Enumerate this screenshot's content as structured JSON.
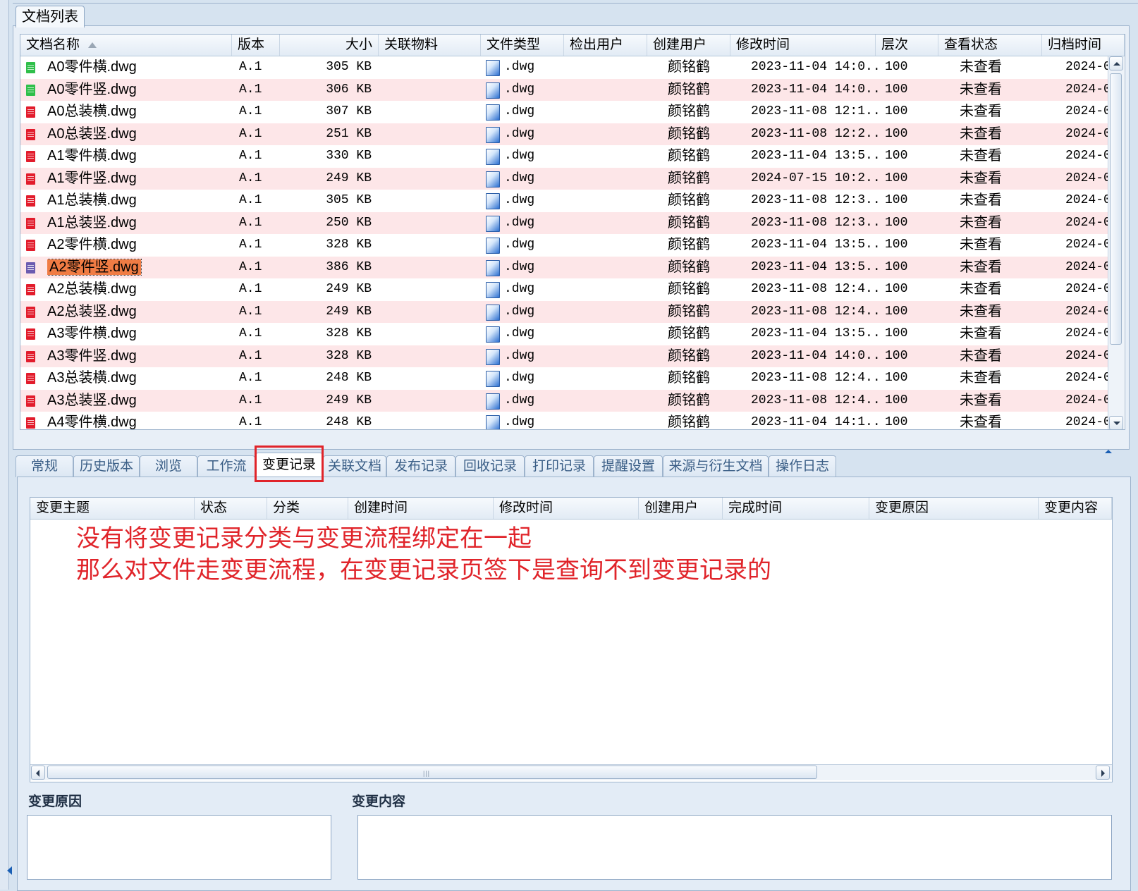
{
  "doc_list_tab": "文档列表",
  "grid1": {
    "columns": [
      "文档名称",
      "版本",
      "大小",
      "关联物料",
      "文件类型",
      "检出用户",
      "创建用户",
      "修改时间",
      "层次",
      "查看状态",
      "归档时间"
    ],
    "sort_column": "文档名称",
    "sort_order": "ascending",
    "rows": [
      {
        "name": "A0零件横.dwg",
        "version": "A.1",
        "size": "305 KB",
        "material": "",
        "type": ".dwg",
        "checkout": "",
        "creator": "颜铭鹤",
        "modified": "2023-11-04 14:0...",
        "level": "100",
        "view": "未查看",
        "archived": "2024-0",
        "icon_color": "#2fbf4a"
      },
      {
        "name": "A0零件竖.dwg",
        "version": "A.1",
        "size": "306 KB",
        "material": "",
        "type": ".dwg",
        "checkout": "",
        "creator": "颜铭鹤",
        "modified": "2023-11-04 14:0...",
        "level": "100",
        "view": "未查看",
        "archived": "2024-0",
        "icon_color": "#2fbf4a"
      },
      {
        "name": "A0总装横.dwg",
        "version": "A.1",
        "size": "307 KB",
        "material": "",
        "type": ".dwg",
        "checkout": "",
        "creator": "颜铭鹤",
        "modified": "2023-11-08 12:1...",
        "level": "100",
        "view": "未查看",
        "archived": "2024-0",
        "icon_color": "#e21c2c"
      },
      {
        "name": "A0总装竖.dwg",
        "version": "A.1",
        "size": "251 KB",
        "material": "",
        "type": ".dwg",
        "checkout": "",
        "creator": "颜铭鹤",
        "modified": "2023-11-08 12:2...",
        "level": "100",
        "view": "未查看",
        "archived": "2024-0",
        "icon_color": "#e21c2c"
      },
      {
        "name": "A1零件横.dwg",
        "version": "A.1",
        "size": "330 KB",
        "material": "",
        "type": ".dwg",
        "checkout": "",
        "creator": "颜铭鹤",
        "modified": "2023-11-04 13:5...",
        "level": "100",
        "view": "未查看",
        "archived": "2024-0",
        "icon_color": "#e21c2c"
      },
      {
        "name": "A1零件竖.dwg",
        "version": "A.1",
        "size": "249 KB",
        "material": "",
        "type": ".dwg",
        "checkout": "",
        "creator": "颜铭鹤",
        "modified": "2024-07-15 10:2...",
        "level": "100",
        "view": "未查看",
        "archived": "2024-0",
        "icon_color": "#e21c2c"
      },
      {
        "name": "A1总装横.dwg",
        "version": "A.1",
        "size": "305 KB",
        "material": "",
        "type": ".dwg",
        "checkout": "",
        "creator": "颜铭鹤",
        "modified": "2023-11-08 12:3...",
        "level": "100",
        "view": "未查看",
        "archived": "2024-0",
        "icon_color": "#e21c2c"
      },
      {
        "name": "A1总装竖.dwg",
        "version": "A.1",
        "size": "250 KB",
        "material": "",
        "type": ".dwg",
        "checkout": "",
        "creator": "颜铭鹤",
        "modified": "2023-11-08 12:3...",
        "level": "100",
        "view": "未查看",
        "archived": "2024-0",
        "icon_color": "#e21c2c"
      },
      {
        "name": "A2零件横.dwg",
        "version": "A.1",
        "size": "328 KB",
        "material": "",
        "type": ".dwg",
        "checkout": "",
        "creator": "颜铭鹤",
        "modified": "2023-11-04 13:5...",
        "level": "100",
        "view": "未查看",
        "archived": "2024-0",
        "icon_color": "#e21c2c"
      },
      {
        "name": "A2零件竖.dwg",
        "version": "A.1",
        "size": "386 KB",
        "material": "",
        "type": ".dwg",
        "checkout": "",
        "creator": "颜铭鹤",
        "modified": "2023-11-04 13:5...",
        "level": "100",
        "view": "未查看",
        "archived": "2024-0",
        "icon_color": "#6b5bb0",
        "selected": true
      },
      {
        "name": "A2总装横.dwg",
        "version": "A.1",
        "size": "249 KB",
        "material": "",
        "type": ".dwg",
        "checkout": "",
        "creator": "颜铭鹤",
        "modified": "2023-11-08 12:4...",
        "level": "100",
        "view": "未查看",
        "archived": "2024-0",
        "icon_color": "#e21c2c"
      },
      {
        "name": "A2总装竖.dwg",
        "version": "A.1",
        "size": "249 KB",
        "material": "",
        "type": ".dwg",
        "checkout": "",
        "creator": "颜铭鹤",
        "modified": "2023-11-08 12:4...",
        "level": "100",
        "view": "未查看",
        "archived": "2024-0",
        "icon_color": "#e21c2c"
      },
      {
        "name": "A3零件横.dwg",
        "version": "A.1",
        "size": "328 KB",
        "material": "",
        "type": ".dwg",
        "checkout": "",
        "creator": "颜铭鹤",
        "modified": "2023-11-04 13:5...",
        "level": "100",
        "view": "未查看",
        "archived": "2024-0",
        "icon_color": "#e21c2c"
      },
      {
        "name": "A3零件竖.dwg",
        "version": "A.1",
        "size": "328 KB",
        "material": "",
        "type": ".dwg",
        "checkout": "",
        "creator": "颜铭鹤",
        "modified": "2023-11-04 14:0...",
        "level": "100",
        "view": "未查看",
        "archived": "2024-0",
        "icon_color": "#e21c2c"
      },
      {
        "name": "A3总装横.dwg",
        "version": "A.1",
        "size": "248 KB",
        "material": "",
        "type": ".dwg",
        "checkout": "",
        "creator": "颜铭鹤",
        "modified": "2023-11-08 12:4...",
        "level": "100",
        "view": "未查看",
        "archived": "2024-0",
        "icon_color": "#e21c2c"
      },
      {
        "name": "A3总装竖.dwg",
        "version": "A.1",
        "size": "249 KB",
        "material": "",
        "type": ".dwg",
        "checkout": "",
        "creator": "颜铭鹤",
        "modified": "2023-11-08 12:4...",
        "level": "100",
        "view": "未查看",
        "archived": "2024-0",
        "icon_color": "#e21c2c"
      },
      {
        "name": "A4零件横.dwg",
        "version": "A.1",
        "size": "248 KB",
        "material": "",
        "type": ".dwg",
        "checkout": "",
        "creator": "颜铭鹤",
        "modified": "2023-11-04 14:1...",
        "level": "100",
        "view": "未查看",
        "archived": "2024-0",
        "icon_color": "#e21c2c"
      }
    ]
  },
  "tabs": [
    {
      "label": "常规"
    },
    {
      "label": "历史版本"
    },
    {
      "label": "浏览"
    },
    {
      "label": "工作流"
    },
    {
      "label": "变更记录",
      "active": true
    },
    {
      "label": "关联文档"
    },
    {
      "label": "发布记录"
    },
    {
      "label": "回收记录"
    },
    {
      "label": "打印记录"
    },
    {
      "label": "提醒设置"
    },
    {
      "label": "来源与衍生文档"
    },
    {
      "label": "操作日志"
    }
  ],
  "grid2": {
    "columns": [
      "变更主题",
      "状态",
      "分类",
      "创建时间",
      "修改时间",
      "创建用户",
      "完成时间",
      "变更原因",
      "变更内容"
    ]
  },
  "annotation": {
    "line1": "没有将变更记录分类与变更流程绑定在一起",
    "line2": "那么对文件走变更流程，在变更记录页签下是查询不到变更记录的",
    "color": "#e0242a"
  },
  "detail": {
    "reason_label": "变更原因",
    "content_label": "变更内容"
  },
  "colors": {
    "row_alt": "#fde6e8",
    "selection": "#f07c44",
    "panel_bg": "#d6e3f0"
  }
}
